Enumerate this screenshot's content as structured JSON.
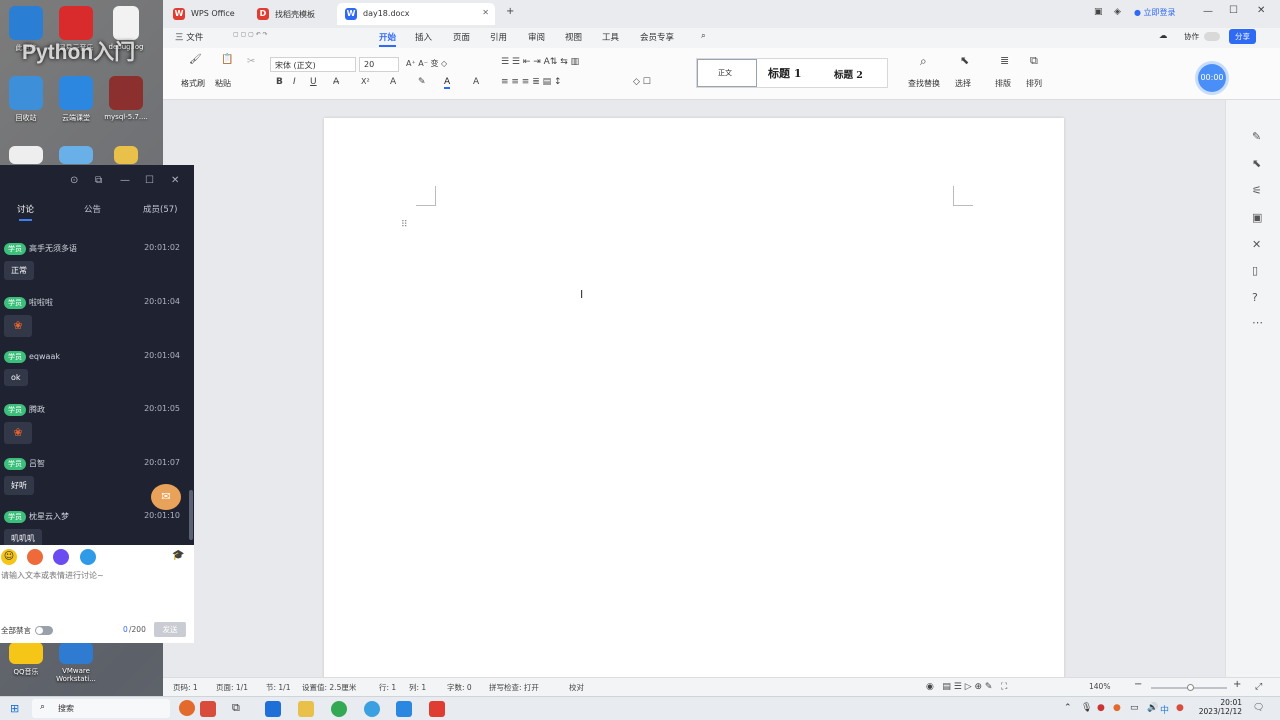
{
  "desktop": {
    "icons": [
      {
        "label": "此电脑",
        "color": "#2a7fd4"
      },
      {
        "label": "网易云音乐",
        "color": "#d92b2b"
      },
      {
        "label": "debug.log",
        "color": "#f2f2f2"
      },
      {
        "label": "回收站",
        "color": "#3c8fd8"
      },
      {
        "label": "云端课堂",
        "color": "#2b87e0"
      },
      {
        "label": "mysql-5.7....",
        "color": "#8b2f2f"
      },
      {
        "label": "QQ音乐",
        "color": "#f5c518"
      },
      {
        "label": "VMware Workstati...",
        "color": "#2f7bd1"
      }
    ],
    "watermark": "Python入门"
  },
  "wps": {
    "tabs": [
      {
        "label": "WPS Office",
        "icon": "wps-logo-icon",
        "color": "#e03c31"
      },
      {
        "label": "找稻壳模板",
        "icon": "docer-icon",
        "color": "#e03c31"
      },
      {
        "label": "day18.docx",
        "icon": "word-doc-icon",
        "color": "#2f6af5"
      }
    ],
    "login_label": "立即登录",
    "ribbon_tabs": [
      "三 文件",
      "开始",
      "插入",
      "页面",
      "引用",
      "审阅",
      "视图",
      "工具",
      "会员专享"
    ],
    "active_ribbon_tab": "开始",
    "collab_label": "协作",
    "share_label": "分享",
    "toolbar": {
      "format_painter": "格式刷",
      "paste": "粘贴",
      "font_name": "宋体 (正文)",
      "font_size": "20",
      "styles": [
        "正文",
        "标题 1",
        "标题 2"
      ],
      "find_replace": "查找替换",
      "select": "选择",
      "layout": "排版",
      "arrange": "排列"
    },
    "timer": "00:00",
    "statusbar": {
      "page_no": "页码: 1",
      "pages": "页面: 1/1",
      "section": "节: 1/1",
      "setting": "设置值: 2.5厘米",
      "row": "行: 1",
      "col": "列: 1",
      "words": "字数: 0",
      "spell": "拼写检查: 打开",
      "proof": "校对",
      "zoom": "140%"
    }
  },
  "chat": {
    "tabs": [
      "讨论",
      "公告",
      "成员(57)"
    ],
    "messages": [
      {
        "badge": "学员",
        "user": "高手无须多语",
        "time": "20:01:02",
        "text": "正常"
      },
      {
        "badge": "学员",
        "user": "啦啦啦",
        "time": "20:01:04",
        "text": ""
      },
      {
        "badge": "学员",
        "user": "eqwaak",
        "time": "20:01:04",
        "text": "ok"
      },
      {
        "badge": "学员",
        "user": "腾政",
        "time": "20:01:05",
        "text": ""
      },
      {
        "badge": "学员",
        "user": "吕智",
        "time": "20:01:07",
        "text": "好听"
      },
      {
        "badge": "学员",
        "user": "枕星云入梦",
        "time": "20:01:10",
        "text": "叽叽叽"
      }
    ],
    "input_placeholder": "请输入文本或表情进行讨论~",
    "mute_all": "全部禁言",
    "counter_current": "0",
    "counter_max": "/200",
    "send_label": "发送"
  },
  "taskbar": {
    "search": "搜索",
    "time": "20:01",
    "date": "2023/12/12",
    "ime": "中"
  }
}
